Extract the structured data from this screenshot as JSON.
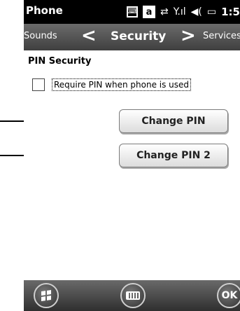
{
  "statusbar": {
    "title": "Phone",
    "clock": "1:5",
    "icons": [
      "keyboard-status-icon",
      "a-input-icon",
      "data-arrows-icon",
      "signal-icon",
      "volume-icon",
      "battery-icon"
    ]
  },
  "tabs": {
    "previous": "Sounds",
    "current": "Security",
    "next": "Services"
  },
  "section": {
    "title": "PIN Security"
  },
  "require_pin": {
    "label": "Require PIN when phone is used",
    "checked": false
  },
  "buttons": {
    "change_pin": "Change PIN",
    "change_pin2": "Change PIN 2"
  },
  "softkeys": {
    "ok": "OK"
  }
}
